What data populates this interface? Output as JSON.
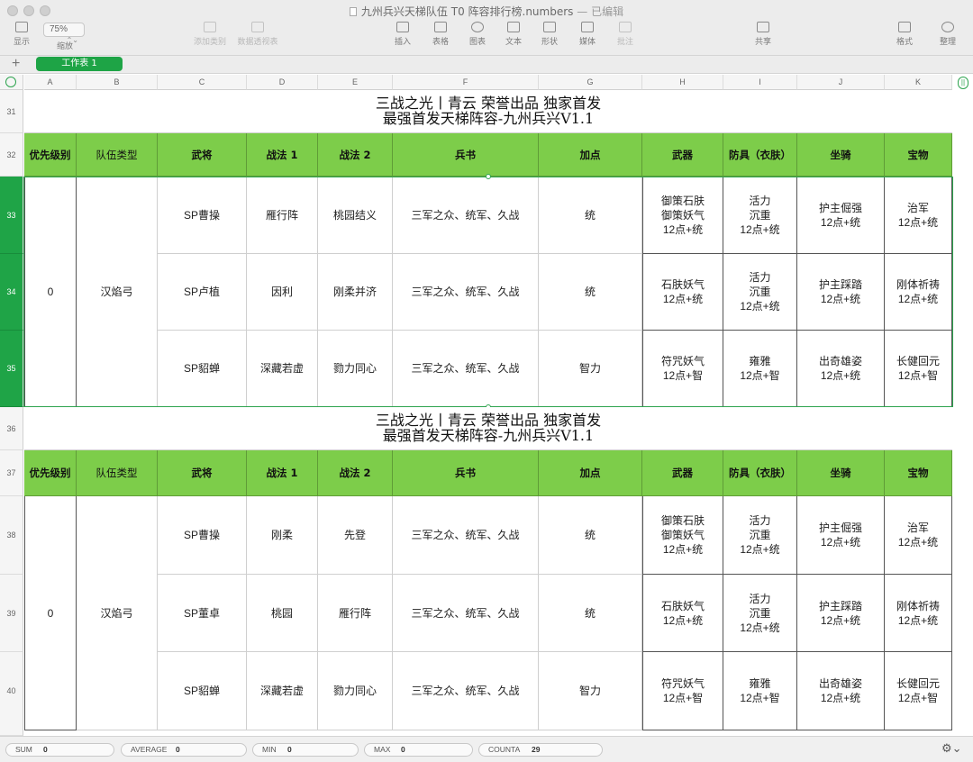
{
  "window": {
    "title": "九州兵兴天梯队伍 T0 阵容排行榜.numbers",
    "status": "— 已编辑"
  },
  "toolbar": {
    "zoom": "75%",
    "items": [
      {
        "label": "显示",
        "icon": "sidebar-icon"
      },
      {
        "label": "缩放",
        "icon": "zoom-icon"
      },
      {
        "label": "添加类别",
        "icon": "category-icon"
      },
      {
        "label": "数据透视表",
        "icon": "pivot-icon"
      },
      {
        "label": "插入",
        "icon": "insert-icon"
      },
      {
        "label": "表格",
        "icon": "table-icon"
      },
      {
        "label": "图表",
        "icon": "chart-icon"
      },
      {
        "label": "文本",
        "icon": "text-icon"
      },
      {
        "label": "形状",
        "icon": "shape-icon"
      },
      {
        "label": "媒体",
        "icon": "media-icon"
      },
      {
        "label": "批注",
        "icon": "comment-icon"
      },
      {
        "label": "共享",
        "icon": "share-icon"
      },
      {
        "label": "格式",
        "icon": "format-icon"
      },
      {
        "label": "整理",
        "icon": "organize-icon"
      }
    ]
  },
  "sheet_tab": "工作表 1",
  "columns": [
    "A",
    "B",
    "C",
    "D",
    "E",
    "F",
    "G",
    "H",
    "I",
    "J",
    "K"
  ],
  "row_numbers": [
    "31",
    "32",
    "33",
    "34",
    "35",
    "36",
    "37",
    "38",
    "39",
    "40"
  ],
  "header_labels": [
    "优先级别",
    "队伍类型",
    "武将",
    "战法 1",
    "战法 2",
    "兵书",
    "加点",
    "武器",
    "防具（衣肤）",
    "坐骑",
    "宝物"
  ],
  "tables": [
    {
      "title_line1": "三战之光丨青云 荣誉出品 独家首发",
      "title_line2": "最强首发天梯阵容-九州兵兴V1.1",
      "priority": "0",
      "team_type": "汉焰弓",
      "rows": [
        {
          "general": "SP曹操",
          "tactic1": "雁行阵",
          "tactic2": "桃园结义",
          "book": "三军之众、统军、久战",
          "points": "统",
          "weapon": "御策石肤\n御策妖气\n12点+统",
          "armor": "活力\n沉重\n12点+统",
          "mount": "护主倔强\n12点+统",
          "treasure": "治军\n12点+统"
        },
        {
          "general": "SP卢植",
          "tactic1": "因利",
          "tactic2": "刚柔并济",
          "book": "三军之众、统军、久战",
          "points": "统",
          "weapon": "石肤妖气\n12点+统",
          "armor": "活力\n沉重\n12点+统",
          "mount": "护主踩踏\n12点+统",
          "treasure": "刚体祈祷\n12点+统"
        },
        {
          "general": "SP貂蝉",
          "tactic1": "深藏若虚",
          "tactic2": "勠力同心",
          "book": "三军之众、统军、久战",
          "points": "智力",
          "weapon": "符咒妖气\n12点+智",
          "armor": "雍雅\n12点+智",
          "mount": "出奇雄姿\n12点+统",
          "treasure": "长健回元\n12点+智"
        }
      ]
    },
    {
      "title_line1": "三战之光丨青云 荣誉出品 独家首发",
      "title_line2": "最强首发天梯阵容-九州兵兴V1.1",
      "priority": "0",
      "team_type": "汉焰弓",
      "rows": [
        {
          "general": "SP曹操",
          "tactic1": "刚柔",
          "tactic2": "先登",
          "book": "三军之众、统军、久战",
          "points": "统",
          "weapon": "御策石肤\n御策妖气\n12点+统",
          "armor": "活力\n沉重\n12点+统",
          "mount": "护主倔强\n12点+统",
          "treasure": "治军\n12点+统"
        },
        {
          "general": "SP董卓",
          "tactic1": "桃园",
          "tactic2": "雁行阵",
          "book": "三军之众、统军、久战",
          "points": "统",
          "weapon": "石肤妖气\n12点+统",
          "armor": "活力\n沉重\n12点+统",
          "mount": "护主踩踏\n12点+统",
          "treasure": "刚体祈祷\n12点+统"
        },
        {
          "general": "SP貂蝉",
          "tactic1": "深藏若虚",
          "tactic2": "勠力同心",
          "book": "三军之众、统军、久战",
          "points": "智力",
          "weapon": "符咒妖气\n12点+智",
          "armor": "雍雅\n12点+智",
          "mount": "出奇雄姿\n12点+统",
          "treasure": "长健回元\n12点+智"
        }
      ]
    }
  ],
  "statusbar": [
    {
      "label": "SUM",
      "value": "0"
    },
    {
      "label": "AVERAGE",
      "value": "0"
    },
    {
      "label": "MIN",
      "value": "0"
    },
    {
      "label": "MAX",
      "value": "0"
    },
    {
      "label": "COUNTA",
      "value": "29"
    }
  ],
  "colors": {
    "header_green": "#7dcd4a",
    "selection_green": "#1fa447",
    "tab_green": "#1ea446"
  }
}
